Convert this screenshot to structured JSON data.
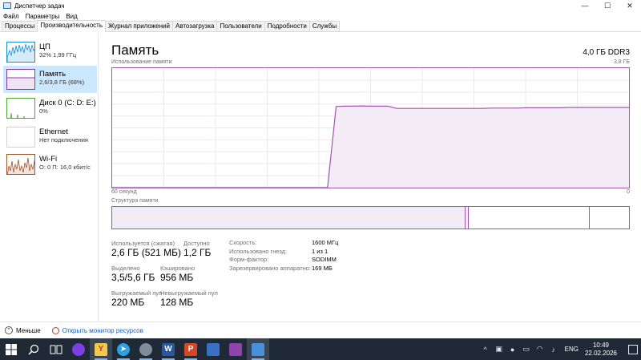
{
  "window": {
    "title": "Диспетчер задач"
  },
  "window_controls": {
    "minimize": "—",
    "maximize": "☐",
    "close": "✕"
  },
  "menu": [
    "Файл",
    "Параметры",
    "Вид"
  ],
  "tabs": [
    {
      "label": "Процессы",
      "active": false
    },
    {
      "label": "Производительность",
      "active": true
    },
    {
      "label": "Журнал приложений",
      "active": false
    },
    {
      "label": "Автозагрузка",
      "active": false
    },
    {
      "label": "Пользователи",
      "active": false
    },
    {
      "label": "Подробности",
      "active": false
    },
    {
      "label": "Службы",
      "active": false
    }
  ],
  "sidebar": {
    "items": [
      {
        "name": "ЦП",
        "sub": "32% 1,99 ГГц",
        "color": "#1b8ad6"
      },
      {
        "name": "Память",
        "sub": "2,6/3,8 ГБ (68%)",
        "color": "#8b3aa6"
      },
      {
        "name": "Диск 0 (C: D: E:)",
        "sub": "0%",
        "color": "#4da72e"
      },
      {
        "name": "Ethernet",
        "sub": "Нет подключения",
        "color": "#b0b0b0"
      },
      {
        "name": "Wi-Fi",
        "sub": "О: 0 П: 16,0 кбит/с",
        "color": "#a0522d"
      }
    ]
  },
  "main": {
    "title": "Память",
    "spec": "4,0 ГБ DDR3",
    "usage_label": "Использование памяти",
    "usage_max": "3,8 ГБ",
    "time_left": "60 секунд",
    "time_right": "0",
    "structure_label": "Структура памяти",
    "accent": "#9a5aa9"
  },
  "stats": {
    "in_use_label": "Используется (сжатая)",
    "in_use_value": "2,6 ГБ (521 МБ)",
    "available_label": "Доступно",
    "available_value": "1,2 ГБ",
    "committed_label": "Выделено",
    "committed_value": "3,5/5,6 ГБ",
    "cached_label": "Кэшировано",
    "cached_value": "956 МБ",
    "paged_label": "Выгружаемый пул",
    "paged_value": "220 МБ",
    "nonpaged_label": "Невыгружаемый пул",
    "nonpaged_value": "128 МБ"
  },
  "props": [
    {
      "key": "Скорость:",
      "value": "1600 МГц"
    },
    {
      "key": "Использовано гнезд:",
      "value": "1 из 1"
    },
    {
      "key": "Форм-фактор:",
      "value": "SODIMM"
    },
    {
      "key": "Зарезервировано аппаратно:",
      "value": "169 МБ"
    }
  ],
  "chart_data": {
    "type": "area",
    "title": "Использование памяти",
    "xlabel": "",
    "ylabel": "",
    "x_range": [
      60,
      0
    ],
    "ylim": [
      0,
      3.8
    ],
    "series": [
      {
        "values": [
          0,
          0,
          0,
          0,
          0,
          0,
          0,
          0,
          0,
          0,
          0,
          0,
          0,
          0,
          0,
          0,
          0,
          0,
          0,
          0,
          0,
          0,
          0,
          0,
          0,
          0,
          2.58,
          2.59,
          2.59,
          2.6,
          2.59,
          2.59,
          2.59,
          2.52,
          2.52,
          2.52,
          2.52,
          2.52,
          2.52,
          2.52,
          2.52,
          2.52,
          2.52,
          2.52,
          2.53,
          2.53,
          2.53,
          2.53,
          2.54,
          2.54,
          2.54,
          2.54,
          2.54,
          2.55,
          2.55,
          2.55,
          2.55,
          2.55,
          2.55,
          2.55,
          2.55
        ]
      }
    ]
  },
  "footer": {
    "less_label": "Меньше",
    "monitor_label": "Открыть монитор ресурсов"
  },
  "taskbar": {
    "apps": [
      "windows-start-icon",
      "search-icon",
      "task-view-icon",
      "alice-icon",
      "yandex-browser-icon",
      "telegram-icon",
      "app-icon",
      "word-icon",
      "powerpoint-icon",
      "floppy-icon",
      "archive-icon",
      "task-manager-icon"
    ],
    "lang": "ENG",
    "time": "10:49",
    "date": "22.02.2026"
  }
}
